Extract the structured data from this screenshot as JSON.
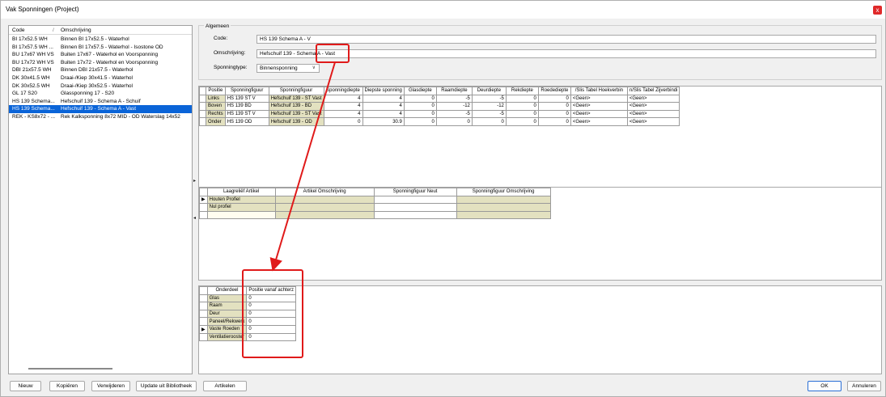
{
  "window": {
    "title": "Vak Sponningen (Project)",
    "close_glyph": "x"
  },
  "list": {
    "columns": [
      "Code",
      "Omschrijving"
    ],
    "sort_glyph": "/",
    "rows": [
      {
        "code": "BI 17x52.5 WH",
        "desc": "Binnen BI 17x52.5 - Waterhol",
        "selected": false
      },
      {
        "code": "BI 17x57.5 WH ...",
        "desc": "Binnen BI 17x57.5 - Waterhol - Isostone OD",
        "selected": false
      },
      {
        "code": "BU 17x67 WH VS",
        "desc": "Buiten 17x67 - Waterhol en Voorsponning",
        "selected": false
      },
      {
        "code": "BU 17x72 WH VS",
        "desc": "Buiten 17x72 - Waterhol en Voorsponning",
        "selected": false
      },
      {
        "code": "DBI 21x57.5 WH",
        "desc": "Binnen DBI 21x57.5 - Waterhol",
        "selected": false
      },
      {
        "code": "DK 30x41.5 WH",
        "desc": "Draai-/Kiep 30x41.5 - Waterhol",
        "selected": false
      },
      {
        "code": "DK 30x52.5 WH",
        "desc": "Draai-/Kiep 30x52.5 - Waterhol",
        "selected": false
      },
      {
        "code": "GL 17 S20",
        "desc": "Glassponning 17 - S20",
        "selected": false
      },
      {
        "code": "HS 139 Schema...",
        "desc": "Hefschuif 139 - Schema A - Schuif",
        "selected": false
      },
      {
        "code": "HS 139 Schema...",
        "desc": "Hefschuif 139 - Schema A - Vast",
        "selected": true
      },
      {
        "code": "REK - KS8x72 - ...",
        "desc": "Rek Kalksponning 8x72 MID - OD Waterslag 14x52",
        "selected": false
      }
    ]
  },
  "general": {
    "legend": "Algemeen",
    "code_label": "Code:",
    "code_value": "HS 139 Schema A - V",
    "desc_label": "Omschrijving:",
    "desc_value": "Hefschuif 139 - Schema A - Vast",
    "type_label": "Sponningtype:",
    "type_value": "Binnensponning"
  },
  "positions_grid": {
    "columns": [
      "Positie",
      "Sponningfiguur",
      "Sponningfiguur",
      "Sponningdiepte",
      "Diepste sponning",
      "Glasdiepte",
      "Raamdiepte",
      "Deurdiepte",
      "Rekdiepte",
      "Roedediepte",
      "/Slis Tabel Hoekverbin",
      "n/Slis Tabel Zijverbindi"
    ],
    "rows": [
      [
        "Links",
        "HS 139 ST V",
        "Hefschuif 139 - ST Vast",
        "4",
        "4",
        "0",
        "-5",
        "-5",
        "0",
        "0",
        "<Geen>",
        "<Geen>"
      ],
      [
        "Boven",
        "HS 139 BD",
        "Hefschuif 139 - BD",
        "4",
        "4",
        "0",
        "-12",
        "-12",
        "0",
        "0",
        "<Geen>",
        "<Geen>"
      ],
      [
        "Rechts",
        "HS 139 ST V",
        "Hefschuif 139 - ST Vast",
        "4",
        "4",
        "0",
        "-5",
        "-5",
        "0",
        "0",
        "<Geen>",
        "<Geen>"
      ],
      [
        "Onder",
        "HS 139 OD",
        "Hefschuif 139 - OD",
        "0",
        "30.9",
        "0",
        "0",
        "0",
        "0",
        "0",
        "<Geen>",
        "<Geen>"
      ]
    ]
  },
  "articles_grid": {
    "columns": [
      "Laagreliëf Artikel",
      "Artikel Omschrijving",
      "Sponningfiguur Neut",
      "Sponningfiguur Omschrijving"
    ],
    "rows": [
      {
        "indicator": "▶",
        "cells": [
          "Houten Profiel",
          "",
          "",
          ""
        ]
      },
      {
        "indicator": "",
        "cells": [
          "Nul profiel",
          "",
          "",
          ""
        ]
      },
      {
        "indicator": "",
        "cells": [
          "",
          "",
          "",
          ""
        ]
      }
    ]
  },
  "parts_grid": {
    "columns": [
      "Onderdeel",
      "Positie vanaf achterz"
    ],
    "rows": [
      {
        "indicator": "",
        "name": "Glas",
        "value": "0"
      },
      {
        "indicator": "",
        "name": "Raam",
        "value": "0"
      },
      {
        "indicator": "",
        "name": "Deur",
        "value": "0"
      },
      {
        "indicator": "",
        "name": "Paneel/Rekwerk",
        "value": "0"
      },
      {
        "indicator": "▶",
        "name": "Vaste Roeden",
        "value": "0"
      },
      {
        "indicator": "",
        "name": "Ventilatierooster",
        "value": "0"
      }
    ]
  },
  "buttons": {
    "new": "Nieuw",
    "copy": "Kopiëren",
    "delete": "Verwijderen",
    "update": "Update uit Bibliotheek",
    "articles": "Artikelen",
    "ok": "OK",
    "cancel": "Annuleren"
  },
  "annotation": {
    "color": "#e01a1a"
  },
  "icons": {
    "dropdown": "chevron-down-icon",
    "splitter_right": "triangle-right-icon",
    "splitter_left": "triangle-left-icon",
    "chevron_glyph": "∨",
    "right_glyph": "▸",
    "left_glyph": "◂"
  }
}
